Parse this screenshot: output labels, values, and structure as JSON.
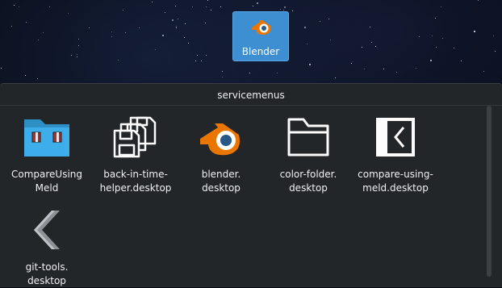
{
  "desktop": {
    "icon": {
      "label": "Blender",
      "icon": "blender-icon",
      "selected": true
    }
  },
  "folder_view": {
    "title": "servicemenus",
    "items": [
      {
        "label": "CompareUsing\nMeld",
        "icon": "folder-icon"
      },
      {
        "label": "back-in-time-\nhelper.desktop",
        "icon": "floppy-disks-icon"
      },
      {
        "label": "blender.\ndesktop",
        "icon": "blender-icon"
      },
      {
        "label": "color-folder.\ndesktop",
        "icon": "folder-outline-icon"
      },
      {
        "label": "compare-using-\nmeld.desktop",
        "icon": "meld-icon"
      },
      {
        "label": "git-tools.\ndesktop",
        "icon": "chevron-left-icon"
      }
    ]
  },
  "colors": {
    "selection": "#3d8fd1",
    "panel": "#232629",
    "folder_blue": "#3daee9",
    "blender_orange": "#ea7600",
    "blender_blue": "#265787"
  }
}
